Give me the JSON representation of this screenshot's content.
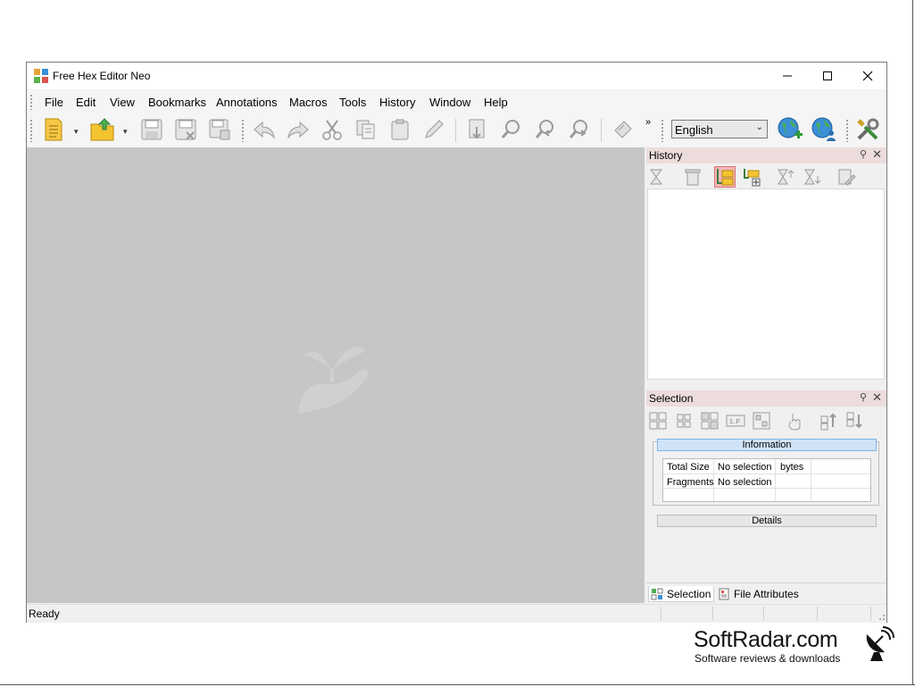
{
  "window": {
    "title": "Free Hex Editor Neo"
  },
  "menu": [
    "File",
    "Edit",
    "View",
    "Bookmarks",
    "Annotations",
    "Macros",
    "Tools",
    "History",
    "Window",
    "Help"
  ],
  "toolbar": {
    "language": "English"
  },
  "history_panel": {
    "title": "History"
  },
  "selection_panel": {
    "title": "Selection",
    "info_header": "Information",
    "rows": [
      {
        "label": "Total Size",
        "value": "No selection",
        "unit": "bytes"
      },
      {
        "label": "Fragments",
        "value": "No selection",
        "unit": ""
      }
    ],
    "details_header": "Details"
  },
  "bottom_tabs": [
    "Selection",
    "File Attributes"
  ],
  "status": {
    "text": "Ready"
  },
  "watermark": {
    "title": "SoftRadar.com",
    "subtitle": "Software reviews & downloads"
  },
  "colors": {
    "workspace": "#c6c6c6",
    "panel_header": "#ecdcdc",
    "info_bar": "#cfe3f7",
    "accent_folder": "#f4c430"
  }
}
